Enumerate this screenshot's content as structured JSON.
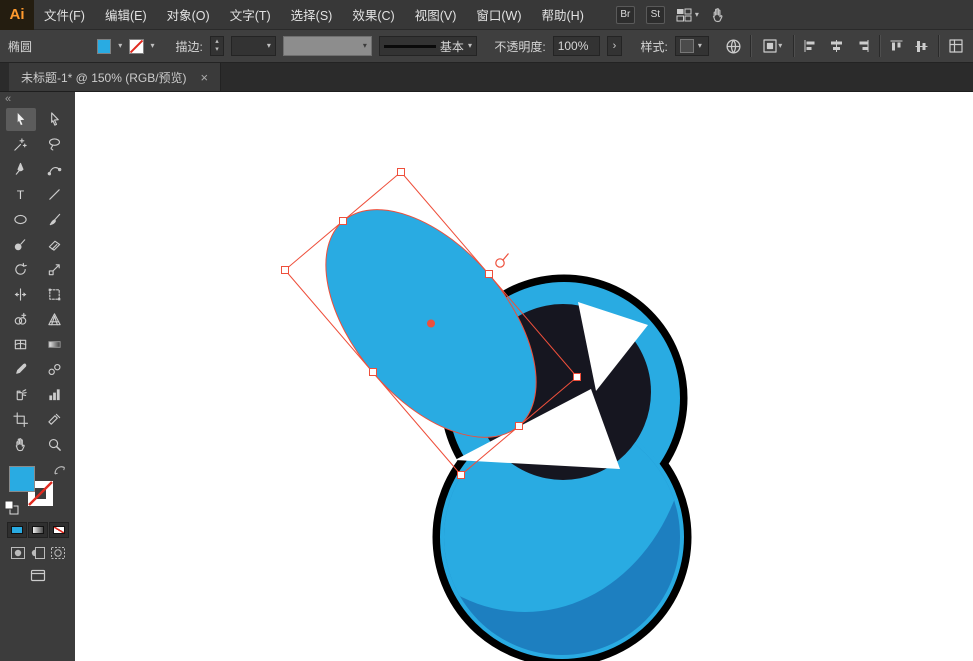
{
  "app": {
    "logo_text": "Ai",
    "menus": [
      "文件(F)",
      "编辑(E)",
      "对象(O)",
      "文字(T)",
      "选择(S)",
      "效果(C)",
      "视图(V)",
      "窗口(W)",
      "帮助(H)"
    ],
    "badges": {
      "bridge": "Br",
      "stock": "St"
    }
  },
  "control_bar": {
    "context_label": "椭圆",
    "stroke_label": "描边:",
    "brush_name": "基本",
    "opacity_label": "不透明度:",
    "opacity_value": "100%",
    "style_label": "样式:"
  },
  "tab": {
    "title": "未标题-1* @ 150% (RGB/预览)",
    "close_glyph": "×"
  },
  "icons": {
    "caret_down": "▾",
    "caret_up": "▴",
    "collapse": "«",
    "forward": "›"
  },
  "tools": [
    "selection",
    "direct-selection",
    "magic-wand",
    "lasso",
    "pen",
    "curvature",
    "type",
    "line-segment",
    "ellipse",
    "paintbrush",
    "blob-brush",
    "eraser",
    "rotate",
    "scale",
    "width",
    "free-transform",
    "shape-builder",
    "perspective-grid",
    "mesh",
    "gradient",
    "eyedropper",
    "blend",
    "symbol-sprayer",
    "column-graph",
    "artboard",
    "slice",
    "hand",
    "zoom"
  ],
  "colors": {
    "fill_swatch": "#29abe2",
    "artwork_blue": "#29abe2",
    "artwork_shade": "#1d7fc0",
    "artwork_dark": "#161620",
    "outline": "#000000",
    "selection": "#ee4f3b",
    "none_slash": "#e02a1f",
    "white": "#ffffff"
  }
}
